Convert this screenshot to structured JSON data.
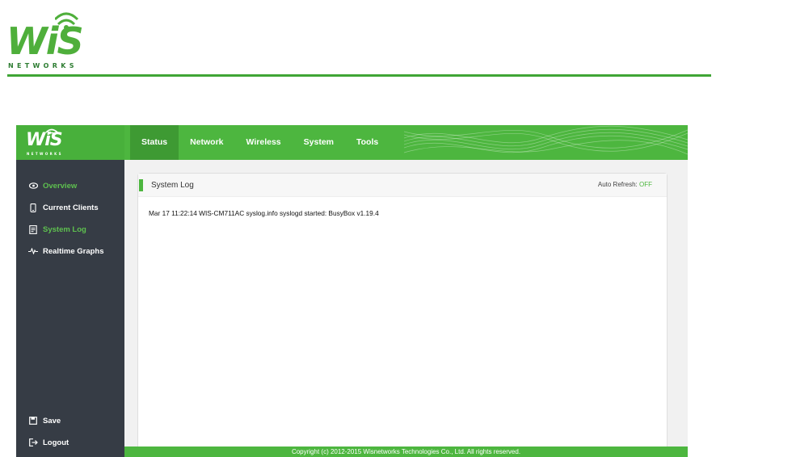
{
  "brand": {
    "logo_text": "WiS",
    "logo_subtext": "NETWORKS"
  },
  "nav": {
    "items": [
      {
        "label": "Status",
        "active": true
      },
      {
        "label": "Network",
        "active": false
      },
      {
        "label": "Wireless",
        "active": false
      },
      {
        "label": "System",
        "active": false
      },
      {
        "label": "Tools",
        "active": false
      }
    ]
  },
  "sidebar": {
    "items": [
      {
        "label": "Overview",
        "icon": "eye-icon",
        "highlighted": true
      },
      {
        "label": "Current Clients",
        "icon": "phone-icon",
        "highlighted": false
      },
      {
        "label": "System Log",
        "icon": "document-icon",
        "highlighted": true
      },
      {
        "label": "Realtime Graphs",
        "icon": "pulse-icon",
        "highlighted": false
      }
    ],
    "bottom": [
      {
        "label": "Save",
        "icon": "save-icon"
      },
      {
        "label": "Logout",
        "icon": "logout-icon"
      }
    ]
  },
  "panel": {
    "title": "System Log",
    "refresh_label": "Auto Refresh: ",
    "refresh_value": "OFF",
    "log": "Mar 17 11:22:14 WIS-CM711AC syslog.info syslogd started: BusyBox v1.19.4"
  },
  "footer": {
    "copyright": "Copyright (c) 2012-2015 Wisnetworks Technologies Co., Ltd. All rights reserved."
  },
  "colors": {
    "accent": "#4db63f",
    "accent_dark": "#3e9a33",
    "sidebar_bg": "#363c45"
  }
}
